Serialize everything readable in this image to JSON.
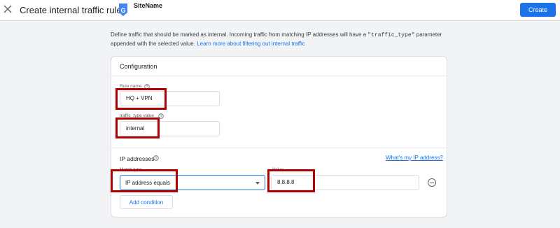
{
  "header": {
    "title": "Create internal traffic rule",
    "site_name": "SiteName",
    "create_label": "Create",
    "close_icon": "close-icon",
    "logo_icon": "google-analytics-icon"
  },
  "intro": {
    "text_before": "Define traffic that should be marked as internal. Incoming traffic from matching IP addresses will have a ",
    "code": "\"traffic_type\"",
    "text_after": " parameter appended with the selected value. ",
    "link": "Learn more about filtering out internal traffic"
  },
  "configuration": {
    "title": "Configuration",
    "rule_name": {
      "label": "Rule name",
      "value": "HQ + VPN"
    },
    "traffic_type": {
      "label": "traffic_type value",
      "value": "internal"
    }
  },
  "ip_addresses": {
    "title": "IP addresses",
    "whats_my_ip": "What's my IP address?",
    "match_type": {
      "label": "Match type",
      "value": "IP address equals"
    },
    "value": {
      "label": "Value",
      "value": "8.8.8.8"
    },
    "add_condition_label": "Add condition"
  },
  "colors": {
    "accent": "#1a73e8",
    "highlight": "#b00000",
    "background": "#f1f3f4"
  }
}
